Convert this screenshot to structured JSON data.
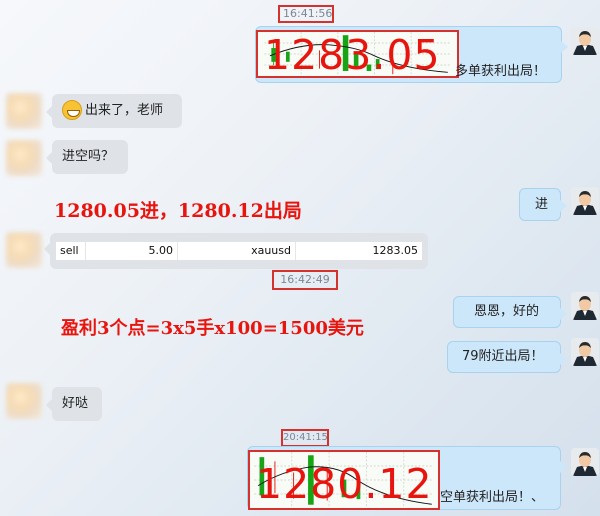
{
  "messages": [
    {
      "time": "16:41:56"
    },
    {
      "caption": "多单获利出局！",
      "price": "1283.05"
    },
    {
      "text": "出来了，老师"
    },
    {
      "text": "进空吗？"
    },
    {
      "text": "进"
    },
    {
      "order": {
        "side": "sell",
        "lots": "5.00",
        "symbol": "xauusd",
        "price": "1283.05"
      }
    },
    {
      "time": "16:42:49"
    },
    {
      "text": "恩恩，好的"
    },
    {
      "text": "79附近出局！"
    },
    {
      "text": "好哒"
    },
    {
      "time": "20:41:15"
    },
    {
      "caption": "空单获利出局！、",
      "price": "1280.12"
    }
  ],
  "annotations": {
    "entry_exit": "1280.05进，1280.12出局",
    "profit": "盈利3个点=3x5手x100=1500美元"
  },
  "colors": {
    "annotation_red": "#e8140e",
    "outline_red": "#d6322d",
    "bubble_blue": "#cde7fa",
    "bubble_gray": "#dfe3e8"
  }
}
